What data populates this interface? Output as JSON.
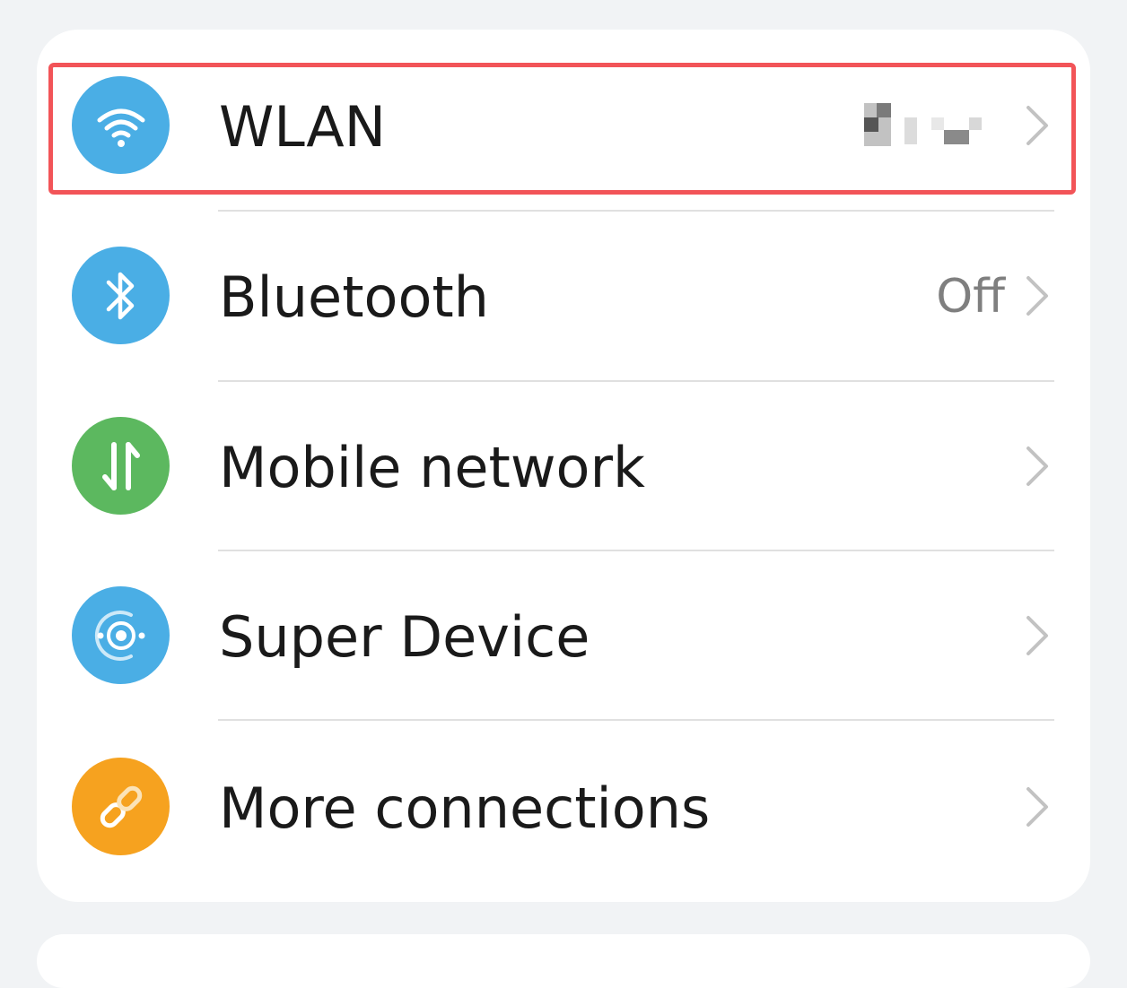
{
  "settings_list": {
    "items": [
      {
        "label": "WLAN",
        "value": "",
        "icon": "wifi-icon",
        "icon_color": "#4aaee5"
      },
      {
        "label": "Bluetooth",
        "value": "Off",
        "icon": "bluetooth-icon",
        "icon_color": "#4aaee5"
      },
      {
        "label": "Mobile network",
        "value": "",
        "icon": "mobile-data-icon",
        "icon_color": "#5cb85f"
      },
      {
        "label": "Super Device",
        "value": "",
        "icon": "super-device-icon",
        "icon_color": "#4aaee5"
      },
      {
        "label": "More connections",
        "value": "",
        "icon": "link-icon",
        "icon_color": "#f6a21f"
      }
    ]
  },
  "highlight": {
    "target": "WLAN",
    "color": "#f25458"
  }
}
